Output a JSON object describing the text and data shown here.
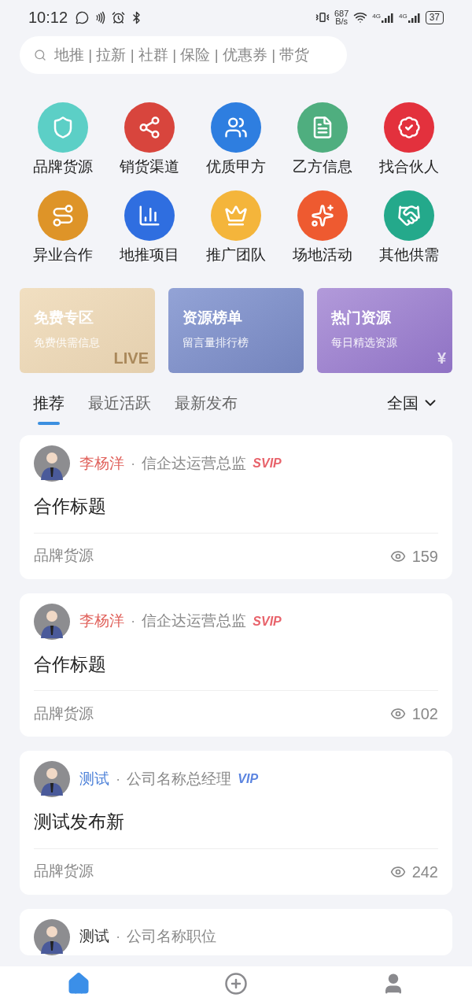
{
  "status_bar": {
    "time": "10:12",
    "net_speed": "687",
    "net_unit": "B/s",
    "sim_1": "4G",
    "sim_2": "4G",
    "battery": "37"
  },
  "search": {
    "placeholder": "地推 | 拉新 | 社群 | 保险 | 优惠券 | 带货"
  },
  "categories": [
    {
      "label": "品牌货源",
      "color": "#5ccfc6"
    },
    {
      "label": "销货渠道",
      "color": "#d8453d"
    },
    {
      "label": "优质甲方",
      "color": "#2e7ee0"
    },
    {
      "label": "乙方信息",
      "color": "#4fae7f"
    },
    {
      "label": "找合伙人",
      "color": "#e3313d"
    },
    {
      "label": "异业合作",
      "color": "#de9428"
    },
    {
      "label": "地推项目",
      "color": "#2f6ee0"
    },
    {
      "label": "推广团队",
      "color": "#f4b53b"
    },
    {
      "label": "场地活动",
      "color": "#ee5a30"
    },
    {
      "label": "其他供需",
      "color": "#24a98b"
    }
  ],
  "promos": [
    {
      "title": "免费专区",
      "subtitle": "免费供需信息",
      "watermark": "LIVE"
    },
    {
      "title": "资源榜单",
      "subtitle": "留言量排行榜"
    },
    {
      "title": "热门资源",
      "subtitle": "每日精选资源",
      "watermark": "¥"
    }
  ],
  "feed_tabs": [
    {
      "label": "推荐",
      "selected": true
    },
    {
      "label": "最近活跃",
      "selected": false
    },
    {
      "label": "最新发布",
      "selected": false
    }
  ],
  "region": "全国",
  "posts": [
    {
      "author": "李杨洋",
      "separator": "·",
      "kind": "svip",
      "badge": "SVIP",
      "company": "信企达运营总监",
      "title": "合作标题",
      "category": "品牌货源",
      "views": "159"
    },
    {
      "author": "李杨洋",
      "separator": "·",
      "kind": "svip",
      "badge": "SVIP",
      "company": "信企达运营总监",
      "title": "合作标题",
      "category": "品牌货源",
      "views": "102"
    },
    {
      "author": "测试",
      "separator": "·",
      "kind": "vip",
      "badge": "VIP",
      "company": "公司名称总经理",
      "title": "测试发布新",
      "category": "品牌货源",
      "views": "242"
    },
    {
      "author": "测试",
      "separator": "·",
      "kind": "plain",
      "company": "公司名称职位"
    }
  ],
  "bottom_nav": [
    {
      "selected": true
    },
    {
      "selected": false
    },
    {
      "selected": false
    }
  ]
}
